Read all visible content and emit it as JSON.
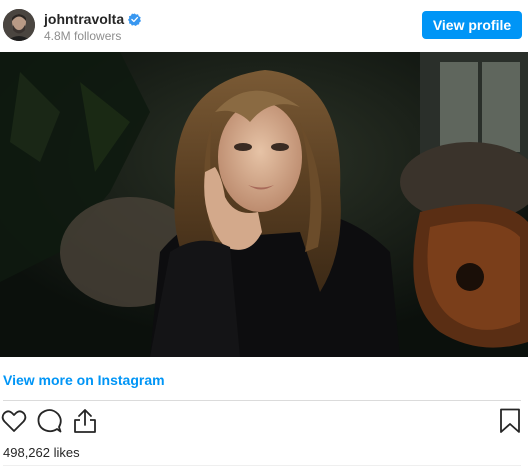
{
  "header": {
    "username": "johntravolta",
    "followers": "4.8M followers",
    "view_profile_label": "View profile",
    "verified_icon": "verified-badge-icon",
    "accent_color": "#0095f6"
  },
  "post": {
    "image_icon": "post-photo",
    "view_more_label": "View more on Instagram",
    "likes": "498,262 likes"
  },
  "actions": {
    "like_icon": "heart-outline-icon",
    "comment_icon": "comment-bubble-icon",
    "share_icon": "share-icon",
    "save_icon": "bookmark-outline-icon"
  }
}
